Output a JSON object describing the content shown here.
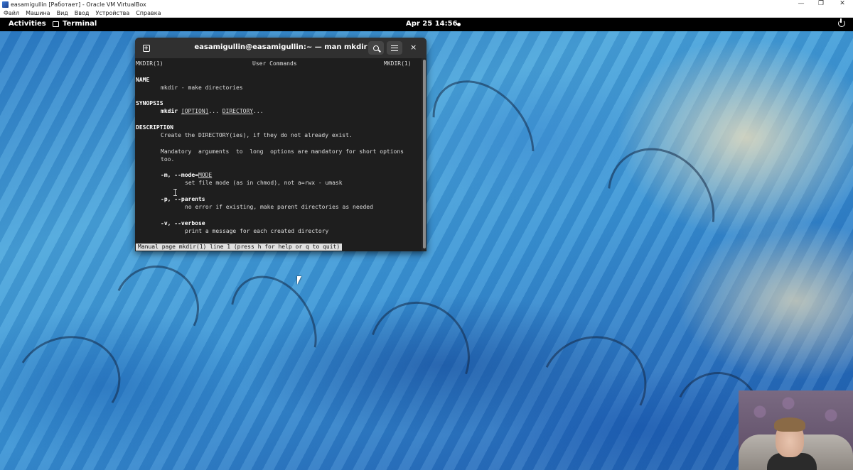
{
  "host_window": {
    "title": "easamigullin [Работает] - Oracle VM VirtualBox",
    "menu": [
      "Файл",
      "Машина",
      "Вид",
      "Ввод",
      "Устройства",
      "Справка"
    ],
    "controls": {
      "minimize": "—",
      "maximize": "❐",
      "close": "✕"
    }
  },
  "topbar": {
    "activities": "Activities",
    "app_name": "Terminal",
    "clock": "Apr 25  14:56"
  },
  "terminal": {
    "title": "easamigullin@easamigullin:~ — man mkdir",
    "close_glyph": "×",
    "man": {
      "header_left": "MKDIR(1)",
      "header_center": "User Commands",
      "header_right": "MKDIR(1)",
      "name_heading": "NAME",
      "name_text": "mkdir - make directories",
      "synopsis_heading": "SYNOPSIS",
      "synopsis_cmd": "mkdir",
      "synopsis_option": "[OPTION]",
      "synopsis_dots1": "...",
      "synopsis_directory": "DIRECTORY",
      "synopsis_dots2": "...",
      "description_heading": "DESCRIPTION",
      "desc_line1": "Create the DIRECTORY(ies), if they do not already exist.",
      "desc_line2": "Mandatory  arguments  to  long  options are mandatory for short options",
      "desc_line3": "too.",
      "opt_m_flags": "-m, --mode=",
      "opt_m_arg": "MODE",
      "opt_m_desc": "set file mode (as in chmod), not a=rwx - umask",
      "opt_p_flags": "-p, --parents",
      "opt_p_desc": "no error if existing, make parent directories as needed",
      "opt_v_flags": "-v, --verbose",
      "opt_v_desc": "print a message for each created directory"
    },
    "status_line": "Manual page mkdir(1) line 1 (press h for help or q to quit)"
  }
}
